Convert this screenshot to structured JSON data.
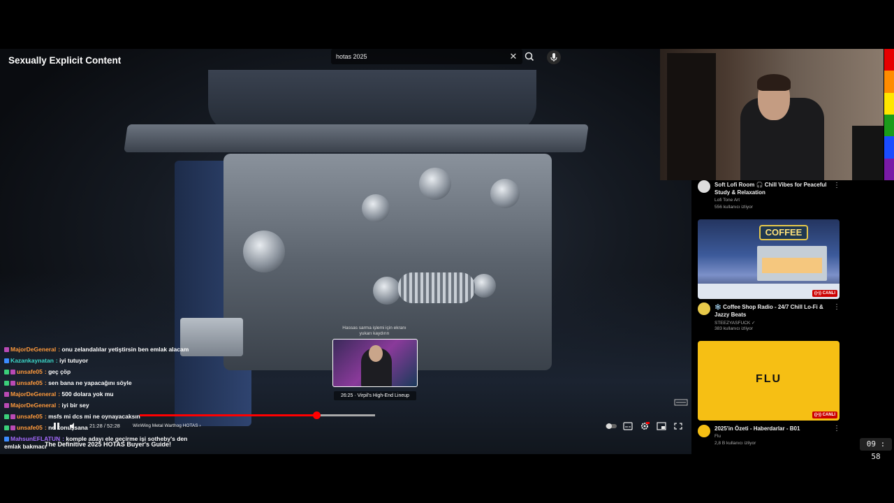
{
  "overlay": {
    "content_warning": "Sexually Explicit Content"
  },
  "search": {
    "query": "hotas 2025",
    "clear_glyph": "✕"
  },
  "chat": [
    {
      "nick": "MajorDeGeneral",
      "message": "onu zelandalılar yetiştirsin ben emlak alacam",
      "nick_color": "#ff9a3c",
      "badges": [
        "#b94ab4"
      ]
    },
    {
      "nick": "Kazankaynatan",
      "message": "iyi tutuyor",
      "nick_color": "#3cd6c8",
      "badges": [
        "#3c8cff"
      ]
    },
    {
      "nick": "unsafe05",
      "message": "geç çöp",
      "nick_color": "#ff9a3c",
      "badges": [
        "#3bd07a",
        "#b94ab4"
      ]
    },
    {
      "nick": "unsafe05",
      "message": "sen bana ne yapacağını söyle",
      "nick_color": "#ff9a3c",
      "badges": [
        "#3bd07a",
        "#b94ab4"
      ]
    },
    {
      "nick": "MajorDeGeneral",
      "message": "500 dolara yok mu",
      "nick_color": "#ff9a3c",
      "badges": [
        "#b94ab4"
      ]
    },
    {
      "nick": "MajorDeGeneral",
      "message": "iyi bir sey",
      "nick_color": "#ff9a3c",
      "badges": [
        "#b94ab4"
      ]
    },
    {
      "nick": "unsafe05",
      "message": "msfs mi dcs mi ne oynayacaksın",
      "nick_color": "#ff9a3c",
      "badges": [
        "#3bd07a",
        "#b94ab4"
      ]
    },
    {
      "nick": "unsafe05",
      "message": "ne konuşsana",
      "nick_color": "#ff9a3c",
      "badges": [
        "#3bd07a",
        "#b94ab4"
      ]
    },
    {
      "nick": "MahsunEFLATUN",
      "message": "komple adayı ele geçirme işi sotheby's den emlak bakmacı",
      "nick_color": "#a66bff",
      "badges": [
        "#3c8cff"
      ]
    }
  ],
  "player": {
    "hover_hint": "Hassas sarma işlemi için ekranı yukarı kaydırın",
    "preview_label": "26:25 · Virpil's High-End Lineup",
    "time": "21:28 / 52:28",
    "chapter": "WinWing Metal Warthog HOTAS",
    "chapter_chevron": "›",
    "title": "The Definitive 2025 HOTAS Buyer's Guide!",
    "progress_played": 0.603,
    "progress_hover": 0.803,
    "accent": "#ff0000",
    "controls": [
      "pause-icon",
      "volume-icon",
      "autoplay-toggle-icon",
      "subtitles-icon",
      "settings-icon",
      "miniplayer-icon",
      "fullscreen-icon"
    ]
  },
  "webcam": {
    "bar_colors": [
      "#e60000",
      "#ff8c00",
      "#ffe600",
      "#1a9c1a",
      "#1a4cff",
      "#7a1aa6"
    ]
  },
  "recommendations": [
    {
      "title": "Soft Lofi Room 🎧 Chill Vibes for Peaceful Study & Relaxation",
      "channel": "Lofi Tone Art",
      "views": "556 kullanıcı izliyor"
    },
    {
      "title": "❄️ Coffee Shop Radio - 24/7 Chill Lo-Fi & Jazzy Beats",
      "channel": "STEEZYASFUCK ✓",
      "views": "383 kullanıcı izliyor",
      "thumb_sign": "COFFEE",
      "live": "CANLI"
    },
    {
      "title": "2025'in Özeti - Haberdarlar - B01",
      "channel": "Flu",
      "views": "2,8 B kullanıcı izliyor",
      "thumb_logo": "FLU",
      "live": "CANLI"
    }
  ],
  "clock": "09 : 58"
}
